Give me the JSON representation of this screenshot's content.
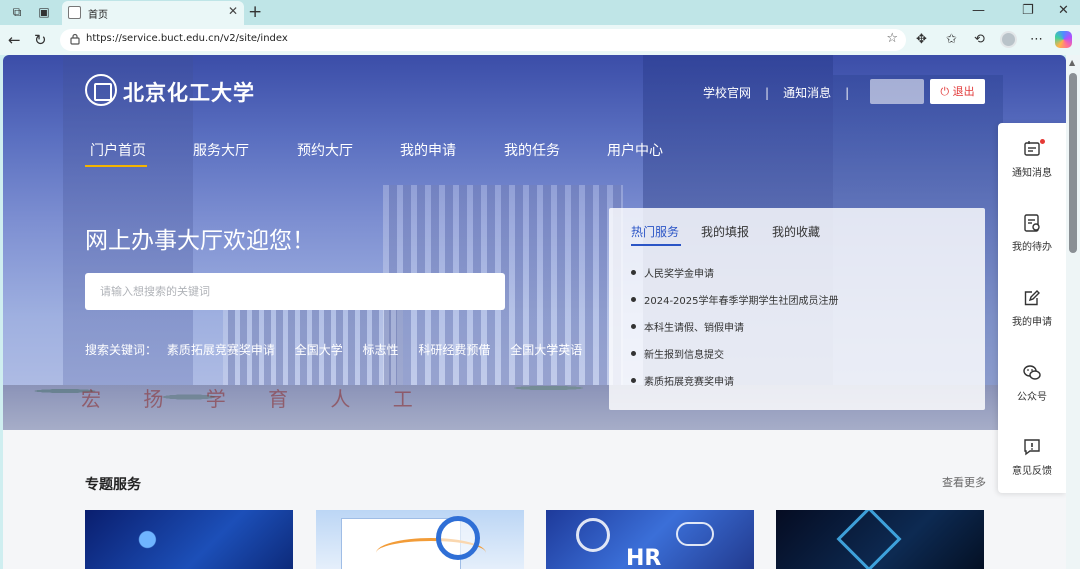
{
  "browser": {
    "tab_title": "首页",
    "url": "https://service.buct.edu.cn/v2/site/index"
  },
  "site": {
    "logo_text": "北京化工大学",
    "top_links": [
      "学校官网",
      "通知消息"
    ],
    "logout_label": "退出"
  },
  "nav": {
    "items": [
      {
        "label": "门户首页",
        "active": true
      },
      {
        "label": "服务大厅"
      },
      {
        "label": "预约大厅"
      },
      {
        "label": "我的申请"
      },
      {
        "label": "我的任务"
      },
      {
        "label": "用户中心"
      }
    ]
  },
  "hero": {
    "welcome": "网上办事大厅欢迎您！",
    "search_placeholder": "请输入想搜索的关键词",
    "keywords_label": "搜索关键词：",
    "keywords": [
      "素质拓展竞赛奖申请",
      "全国大学",
      "标志性",
      "科研经费预借",
      "全国大学英语"
    ],
    "calligraphy": "宏 扬 学 育 人 工"
  },
  "panel": {
    "tabs": [
      {
        "label": "热门服务",
        "active": true
      },
      {
        "label": "我的填报"
      },
      {
        "label": "我的收藏"
      }
    ],
    "items": [
      "人民奖学金申请",
      "2024-2025学年春季学期学生社团成员注册",
      "本科生请假、销假申请",
      "新生报到信息提交",
      "素质拓展竞赛奖申请"
    ]
  },
  "sidetool": {
    "items": [
      {
        "label": "通知消息",
        "icon": "notification-icon",
        "badge": true
      },
      {
        "label": "我的待办",
        "icon": "todo-icon"
      },
      {
        "label": "我的申请",
        "icon": "edit-icon"
      },
      {
        "label": "公众号",
        "icon": "wechat-icon"
      },
      {
        "label": "意见反馈",
        "icon": "feedback-icon"
      }
    ]
  },
  "section": {
    "title": "专题服务",
    "see_more": "查看更多",
    "card_overlay_text": "HR"
  },
  "colors": {
    "accent_blue": "#2b55c6",
    "nav_underline": "#f4b400",
    "logout_red": "#e23a3a",
    "badge_red": "#e53935"
  }
}
